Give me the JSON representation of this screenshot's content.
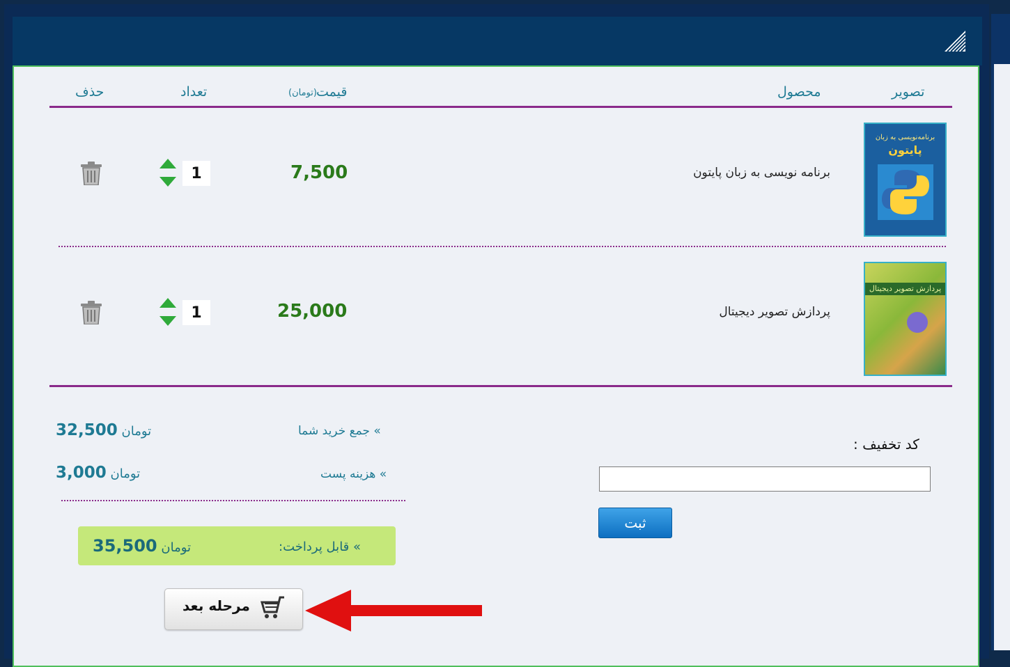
{
  "table": {
    "headers": {
      "image": "تصویر",
      "product": "محصول",
      "price": "قیمت",
      "price_unit": "(تومان)",
      "quantity": "تعداد",
      "delete": "حذف"
    },
    "rows": [
      {
        "name": "برنامه نویسی به زبان پایتون",
        "price": "7,500",
        "quantity": "1",
        "cover_title_line1": "برنامه‌نویسی به زبان",
        "cover_title_line2": "پایتون",
        "cover_color": "#1b5f9f"
      },
      {
        "name": "پردازش تصویر دیجیتال",
        "price": "25,000",
        "quantity": "1",
        "cover_title_line1": "پردازش تصویر دیجیتال",
        "cover_color": "#8ab83a"
      }
    ]
  },
  "summary": {
    "total_label": "» جمع خرید شما",
    "total_value": "32,500",
    "shipping_label": "» هزینه پست",
    "shipping_value": "3,000",
    "currency": "تومان",
    "payable_label": "» قابل پرداخت:",
    "payable_value": "35,500"
  },
  "discount": {
    "label": "کد تخفیف :",
    "input_value": "",
    "submit_label": "ثبت"
  },
  "next_button": {
    "label": "مرحله بعد"
  },
  "colors": {
    "header": "#063864",
    "divider": "#8a2a8a",
    "price": "#2a7a1a",
    "payable_bg": "#c5e87a",
    "submit": "#1a80d0",
    "arrow": "#e01010"
  },
  "icons": {
    "logo": "stripes-logo-icon",
    "quantity": "up-down-arrows-icon",
    "delete": "trash-icon",
    "cart": "cart-icon",
    "annotation": "red-arrow-icon"
  }
}
